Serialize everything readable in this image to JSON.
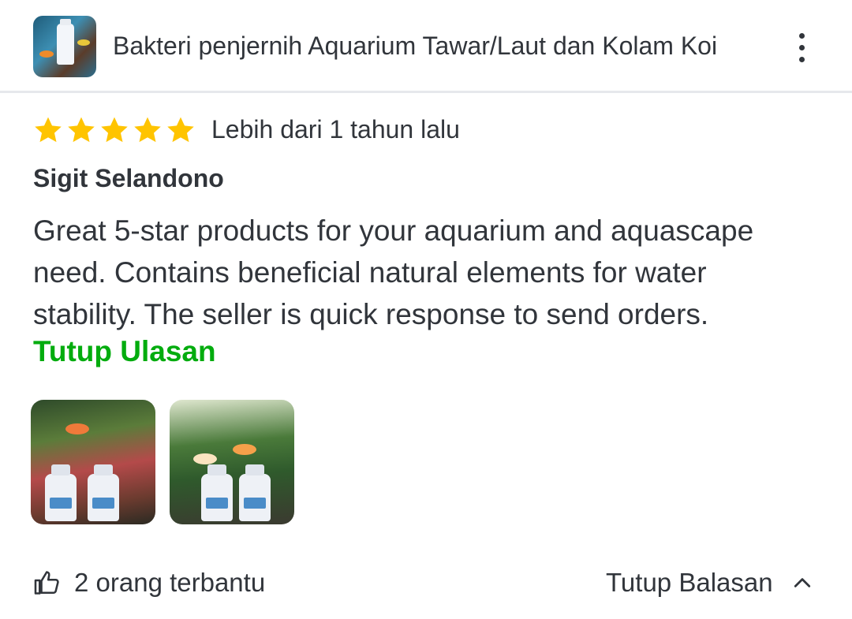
{
  "header": {
    "product_title": "Bakteri penjernih Aquarium Tawar/Laut dan Kolam Koi",
    "thumbnail_icon": "product-thumbnail",
    "menu_icon": "more-vertical-icon"
  },
  "review": {
    "rating": 5,
    "max_rating": 5,
    "star_color": "#ffc400",
    "time_ago": "Lebih dari 1 tahun lalu",
    "reviewer_name": "Sigit Selandono",
    "text_lines": [
      "Great 5-star products for your aquarium and aquascape",
      "need. Contains beneficial natural elements for water",
      "stability. The seller is quick response to send orders."
    ],
    "close_review_label": "Tutup Ulasan",
    "accent_color": "#03ac0e",
    "photos": [
      {
        "icon": "review-photo-1"
      },
      {
        "icon": "review-photo-2"
      }
    ]
  },
  "footer": {
    "helpful_icon": "thumbs-up-icon",
    "helpful_label": "2 orang terbantu",
    "toggle_replies_label": "Tutup Balasan",
    "toggle_icon": "chevron-up-icon"
  }
}
